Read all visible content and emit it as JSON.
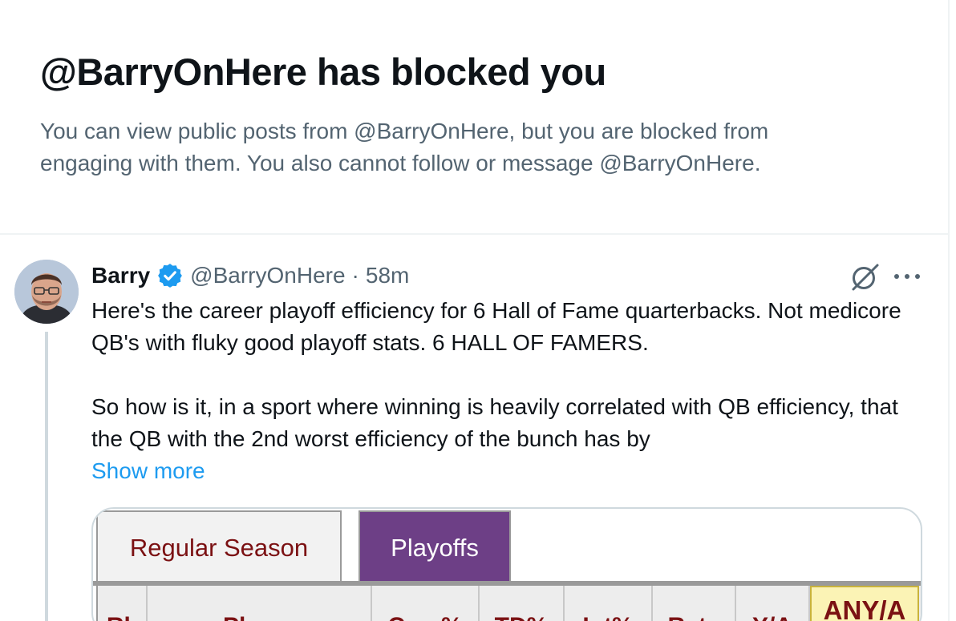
{
  "blocked_notice": {
    "title": "@BarryOnHere has blocked you",
    "description": "You can view public posts from @BarryOnHere, but you are blocked from engaging with them. You also cannot follow or message @BarryOnHere."
  },
  "tweet": {
    "author_name": "Barry",
    "handle": "@BarryOnHere",
    "separator": "·",
    "timestamp": "58m",
    "body_paragraph_1": "Here's the career playoff efficiency for 6 Hall of Fame quarterbacks. Not medicore QB's with fluky good playoff stats. 6 HALL OF FAMERS.",
    "body_paragraph_2": "So how is it, in a sport where winning is heavily correlated with QB efficiency, that the QB with the 2nd worst efficiency of the bunch has by",
    "show_more_label": "Show more",
    "icons": {
      "verified": "verified-badge-icon",
      "grok": "grok-icon",
      "more": "more-options-icon"
    },
    "media": {
      "tabs": [
        {
          "label": "Regular Season",
          "active": false
        },
        {
          "label": "Playoffs",
          "active": true
        }
      ],
      "columns": [
        "Rk",
        "Player",
        "Cmp%",
        "TD%",
        "Int%",
        "Rate",
        "Y/A",
        "ANY/A"
      ]
    }
  },
  "colors": {
    "text_primary": "#0f1419",
    "text_secondary": "#536471",
    "link": "#1d9bf0",
    "verified": "#1d9bf0",
    "tab_active_bg": "#6d3f86",
    "header_text": "#7b1113",
    "highlight_bg": "#fbf3b5"
  }
}
